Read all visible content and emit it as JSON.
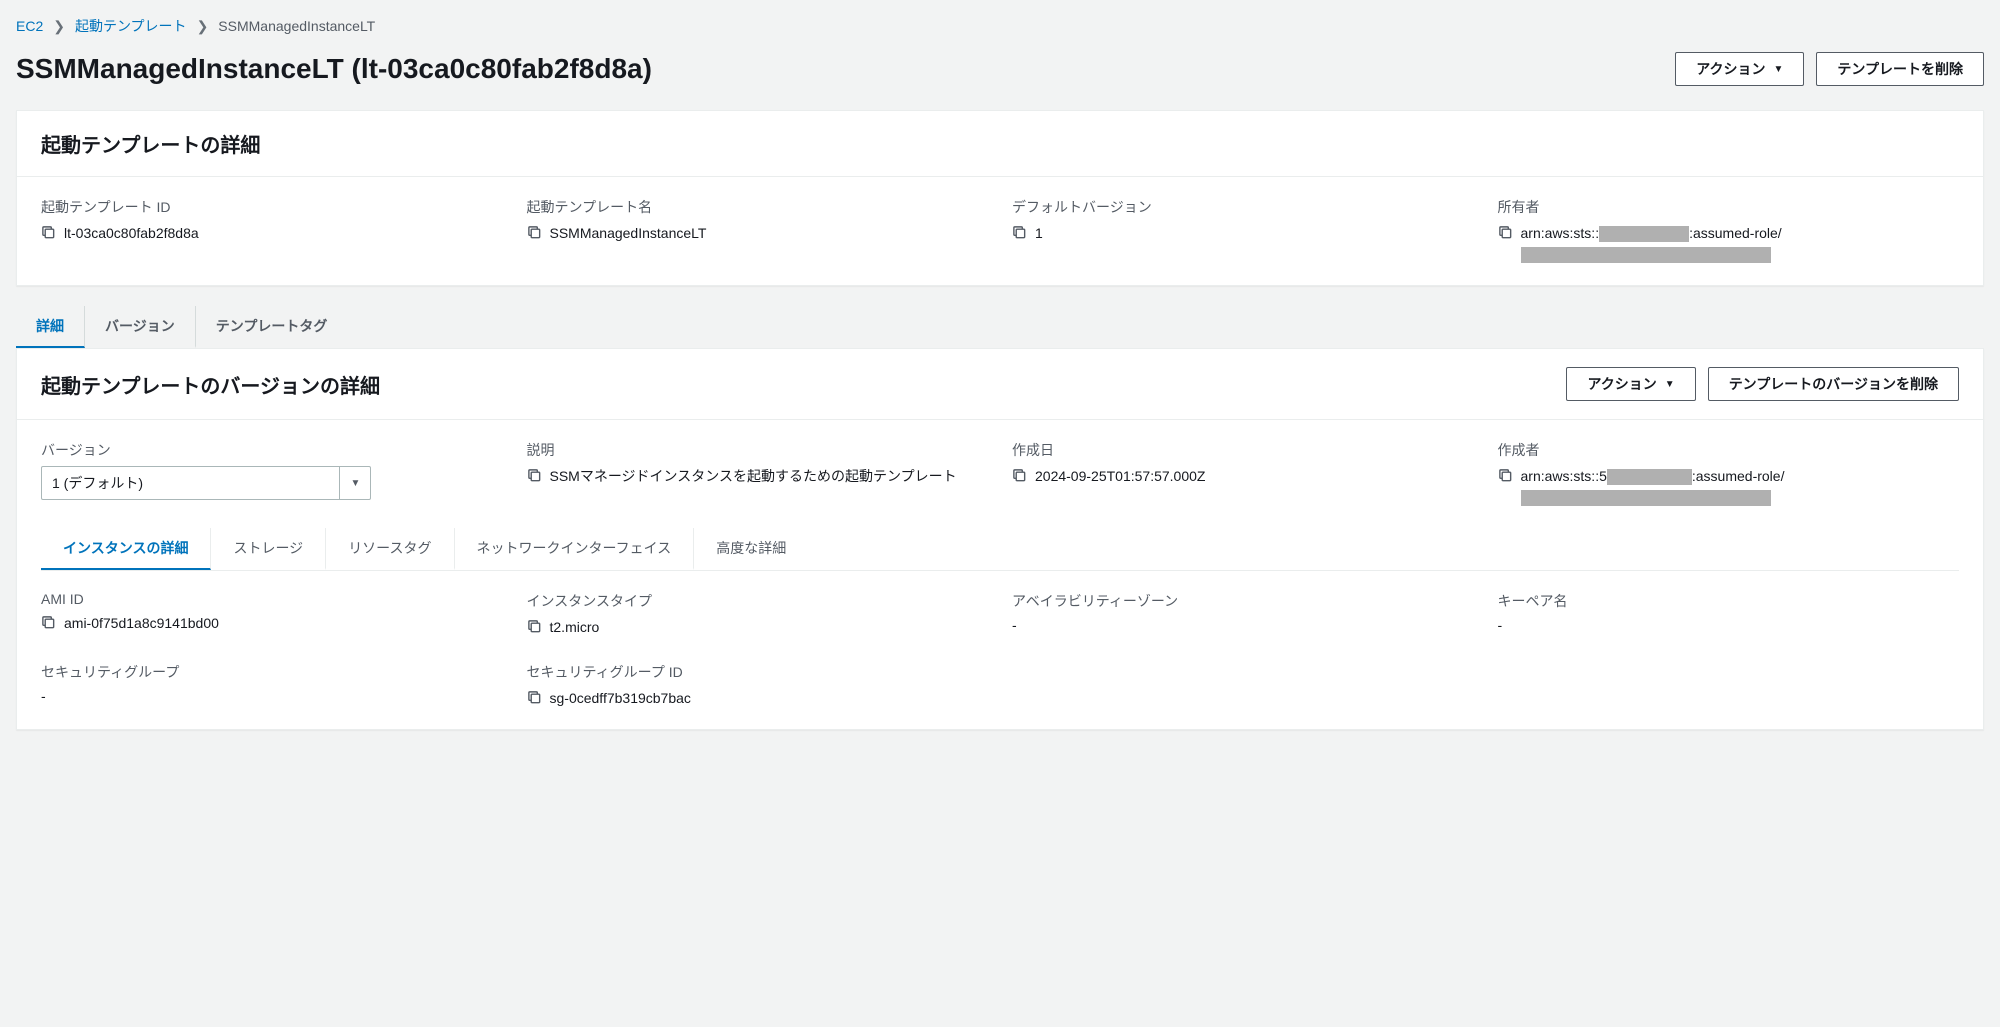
{
  "breadcrumb": {
    "root": "EC2",
    "parent": "起動テンプレート",
    "current": "SSMManagedInstanceLT"
  },
  "header": {
    "title": "SSMManagedInstanceLT (lt-03ca0c80fab2f8d8a)",
    "actions_label": "アクション",
    "delete_label": "テンプレートを削除"
  },
  "details_panel": {
    "title": "起動テンプレートの詳細",
    "fields": {
      "lt_id_label": "起動テンプレート ID",
      "lt_id_value": "lt-03ca0c80fab2f8d8a",
      "lt_name_label": "起動テンプレート名",
      "lt_name_value": "SSMManagedInstanceLT",
      "default_ver_label": "デフォルトバージョン",
      "default_ver_value": "1",
      "owner_label": "所有者",
      "owner_prefix": "arn:aws:sts::",
      "owner_mid": ":assumed-role/"
    }
  },
  "tabs": {
    "detail": "詳細",
    "version": "バージョン",
    "template_tag": "テンプレートタグ"
  },
  "version_panel": {
    "title": "起動テンプレートのバージョンの詳細",
    "actions_label": "アクション",
    "delete_label": "テンプレートのバージョンを削除",
    "version_label": "バージョン",
    "version_selected": "1 (デフォルト)",
    "desc_label": "説明",
    "desc_value": "SSMマネージドインスタンスを起動するための起動テンプレート",
    "created_label": "作成日",
    "created_value": "2024-09-25T01:57:57.000Z",
    "creator_label": "作成者",
    "creator_prefix": "arn:aws:sts::5",
    "creator_mid": ":assumed-role/"
  },
  "inner_tabs": {
    "instance": "インスタンスの詳細",
    "storage": "ストレージ",
    "resource_tag": "リソースタグ",
    "network": "ネットワークインターフェイス",
    "advanced": "高度な詳細"
  },
  "instance_fields": {
    "ami_label": "AMI ID",
    "ami_value": "ami-0f75d1a8c9141bd00",
    "type_label": "インスタンスタイプ",
    "type_value": "t2.micro",
    "az_label": "アベイラビリティーゾーン",
    "az_value": "-",
    "keypair_label": "キーペア名",
    "keypair_value": "-",
    "sg_label": "セキュリティグループ",
    "sg_value": "-",
    "sg_id_label": "セキュリティグループ ID",
    "sg_id_value": "sg-0cedff7b319cb7bac"
  }
}
